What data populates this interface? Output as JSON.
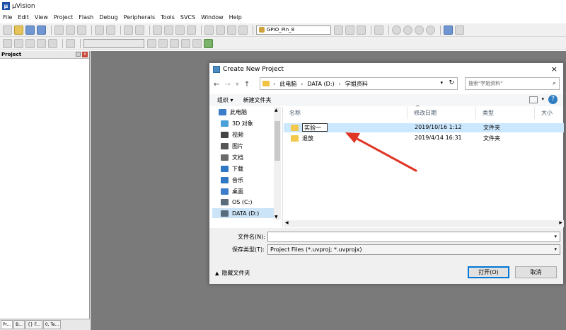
{
  "app": {
    "title": "µVision",
    "logo": "µ"
  },
  "menu": [
    "File",
    "Edit",
    "View",
    "Project",
    "Flash",
    "Debug",
    "Peripherals",
    "Tools",
    "SVCS",
    "Window",
    "Help"
  ],
  "toolbar": {
    "target": "GPIO_Pin_8"
  },
  "project_pane": {
    "title": "Project",
    "tabs": [
      "Pr...",
      "B...",
      "{} F...",
      "0, Te..."
    ]
  },
  "dialog": {
    "title": "Create New Project",
    "close": "×",
    "breadcrumb": [
      "此电脑",
      "DATA (D:)",
      "学姐资料"
    ],
    "search_placeholder": "搜索\"学姐资料\"",
    "organize": "组织 ▾",
    "new_folder": "新建文件夹",
    "help": "?",
    "nav_tree": [
      {
        "label": "此电脑",
        "icon": "computer-icon",
        "color": "#3d7cc9"
      },
      {
        "label": "3D 对象",
        "icon": "3d-objects-icon",
        "color": "#4aa0d8"
      },
      {
        "label": "视频",
        "icon": "video-icon",
        "color": "#444444"
      },
      {
        "label": "图片",
        "icon": "pictures-icon",
        "color": "#555555"
      },
      {
        "label": "文档",
        "icon": "documents-icon",
        "color": "#6a6a6a"
      },
      {
        "label": "下载",
        "icon": "downloads-icon",
        "color": "#2f78c4"
      },
      {
        "label": "音乐",
        "icon": "music-icon",
        "color": "#2f78c4"
      },
      {
        "label": "桌面",
        "icon": "desktop-icon",
        "color": "#3d7cc9"
      },
      {
        "label": "OS (C:)",
        "icon": "drive-icon",
        "color": "#5a6b7c"
      },
      {
        "label": "DATA (D:)",
        "icon": "drive-icon",
        "color": "#5a6b7c"
      }
    ],
    "columns": {
      "name": "名称",
      "date": "修改日期",
      "type": "类型",
      "size": "大小"
    },
    "files": [
      {
        "name": "实验一",
        "date": "2019/10/16 1:12",
        "type": "文件夹"
      },
      {
        "name": "退放",
        "date": "2019/4/14 16:31",
        "type": "文件夹"
      }
    ],
    "filename_label": "文件名(N):",
    "filename_value": "",
    "filetype_label": "保存类型(T):",
    "filetype_value": "Project Files (*.uvproj; *.uvprojx)",
    "hide_folders": "隐藏文件夹",
    "open_button": "打开(O)",
    "cancel_button": "取消"
  },
  "colors": {
    "workspace": "#7a7a7a",
    "annotation_arrow": "#e03525",
    "selection": "#cce8ff"
  }
}
